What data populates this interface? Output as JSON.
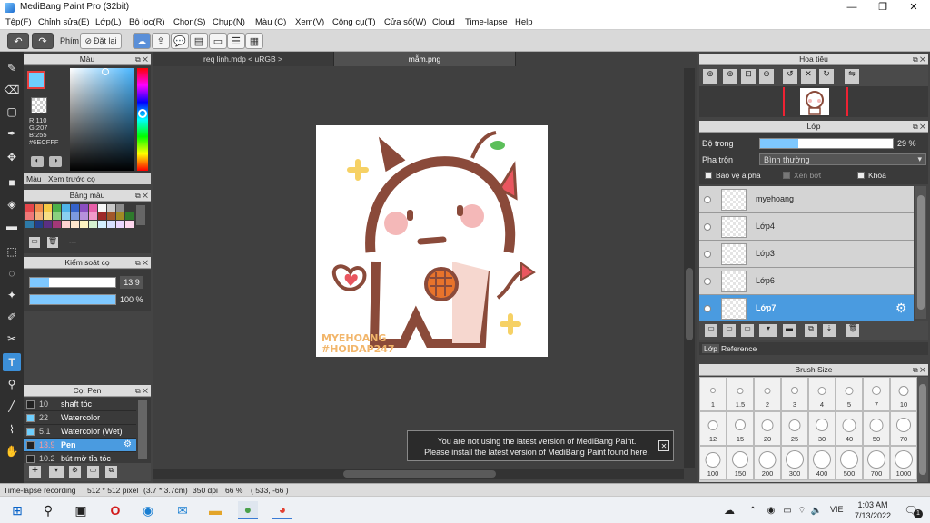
{
  "window": {
    "title": "MediBang Paint Pro (32bit)",
    "minimize": "—",
    "maximize": "❐",
    "close": "✕"
  },
  "menu": [
    "Tệp(F)",
    "Chỉnh sửa(E)",
    "Lớp(L)",
    "Bộ lọc(R)",
    "Chọn(S)",
    "Chụp(N)",
    "Màu (C)",
    "Xem(V)",
    "Công cụ(T)",
    "Cửa sổ(W)",
    "Cloud",
    "Time-lapse",
    "Help"
  ],
  "toolbar": {
    "phim_label": "Phím",
    "reset_label": "Đặt lại"
  },
  "color_panel": {
    "title": "Màu",
    "readout": {
      "r": "R:110",
      "g": "G:207",
      "b": "B:255",
      "hex": "#6ECFFF"
    },
    "tab_color": "Màu",
    "tab_preview": "Xem trước cọ",
    "primary_color": "#6ecfff"
  },
  "palette_panel": {
    "title": "Bảng màu",
    "swatches": [
      "#e5454a",
      "#f08a4b",
      "#f6c945",
      "#4db04a",
      "#4fb3e8",
      "#3562c9",
      "#8a4fc1",
      "#e65fa8",
      "#f7f7f7",
      "#c9c9c9",
      "#8c8c8c",
      "#3a3a3a",
      "#ef7878",
      "#f5b27a",
      "#f7dd85",
      "#8ad07f",
      "#8bd0f0",
      "#7c99df",
      "#b690dc",
      "#f19acb",
      "#9e2a2a",
      "#a2572a",
      "#a08a24",
      "#2e7a2c",
      "#2d7aa8",
      "#23408a",
      "#5a2f83",
      "#a33878",
      "#ffd2d2",
      "#ffe6cc",
      "#fff5c2",
      "#d7f2d0",
      "#d4efff",
      "#d7e0ff",
      "#ead7ff",
      "#ffd7ee",
      "#ff0000",
      "#ff8000",
      "#ffff00",
      "#00ff00",
      "#00ffff",
      "#0000ff",
      "#ff00ff",
      "#ff0080"
    ],
    "more": "---"
  },
  "brush_control": {
    "title": "Kiểm soát cọ",
    "size_value": "13.9",
    "size_fill": 0.22,
    "opacity_label": "100 %",
    "opacity_fill": 1.0
  },
  "brush_panel": {
    "title": "Cọ: Pen",
    "items": [
      {
        "size": "10",
        "name": "shaft tóc",
        "selected": false,
        "color": "#222222"
      },
      {
        "size": "22",
        "name": "Watercolor",
        "selected": false,
        "color": "#6ecfff"
      },
      {
        "size": "5.1",
        "name": "Watercolor (Wet)",
        "selected": false,
        "color": "#6ecfff"
      },
      {
        "size": "13.9",
        "name": "Pen",
        "selected": true,
        "color": "#222222"
      },
      {
        "size": "10.2",
        "name": "bút mờ tỉa tóc",
        "selected": false,
        "color": "#222222"
      }
    ]
  },
  "tabs": {
    "doc1": "req linh.mdp < uRGB >",
    "doc2": "mẫm.png"
  },
  "artwork": {
    "watermark_line1": "MYEHOANG",
    "watermark_line2": "#HOIDAP247"
  },
  "notice": {
    "line1": "You are not using the latest version of MediBang Paint.",
    "line2": "Please install the latest version of MediBang Paint found here.",
    "close": "✕"
  },
  "navigator": {
    "title": "Hoa tiêu"
  },
  "layer_panel": {
    "title": "Lớp",
    "opacity_label": "Độ trong",
    "opacity_value": "29 %",
    "opacity_fill": 0.29,
    "blend_label": "Pha trộn",
    "blend_value": "Bình thường",
    "protect_alpha": "Bảo vệ alpha",
    "clipping": "Xén bớt",
    "lock": "Khóa",
    "layers": [
      {
        "name": "myehoang",
        "selected": false
      },
      {
        "name": "Lớp4",
        "selected": false
      },
      {
        "name": "Lớp3",
        "selected": false
      },
      {
        "name": "Lớp6",
        "selected": false
      },
      {
        "name": "Lớp7",
        "selected": true
      }
    ],
    "tab_layer": "Lớp",
    "tab_reference": "Reference"
  },
  "brush_size": {
    "title": "Brush Size",
    "sizes": [
      "1",
      "1.5",
      "2",
      "3",
      "4",
      "5",
      "7",
      "10",
      "12",
      "15",
      "20",
      "25",
      "30",
      "40",
      "50",
      "70",
      "100",
      "150",
      "200",
      "300",
      "400",
      "500",
      "700",
      "1000"
    ]
  },
  "status": {
    "recording": "Time-lapse recording",
    "dims": "512 * 512 pixel",
    "cm": "(3.7 * 3.7cm)",
    "dpi": "350 dpi",
    "zoom": "66 %",
    "coords": "( 533, -66 )"
  },
  "taskbar": {
    "lang": "VIE",
    "time": "1:03 AM",
    "date": "7/13/2022",
    "notif_count": "1"
  }
}
